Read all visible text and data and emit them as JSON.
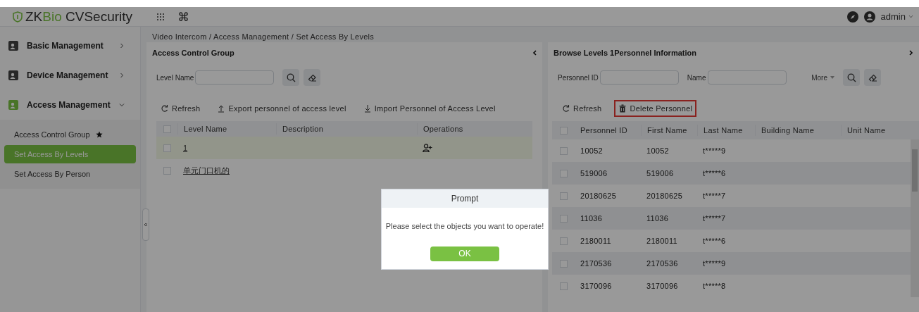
{
  "header": {
    "logo": {
      "part_1": "ZK",
      "part_2": "Bio",
      "part_3": " CVSecurity"
    },
    "user": "admin"
  },
  "sidebar": {
    "menus": [
      {
        "label": "Basic Management",
        "expanded": false
      },
      {
        "label": "Device Management",
        "expanded": false
      },
      {
        "label": "Access Management",
        "expanded": true,
        "items": [
          {
            "label": "Access Control Group",
            "selected": false,
            "starred": true
          },
          {
            "label": "Set Access By Levels",
            "selected": true,
            "starred": false
          },
          {
            "label": "Set Access By Person",
            "selected": false,
            "starred": false
          }
        ]
      }
    ]
  },
  "breadcrumb": "Video Intercom / Access Management / Set Access By Levels",
  "left_panel": {
    "title": "Access Control Group",
    "filters": [
      {
        "label": "Level Name"
      }
    ],
    "actions": [
      {
        "kind": "refresh",
        "label": "Refresh",
        "highlighted": false
      },
      {
        "kind": "export",
        "label": "Export personnel of access level",
        "highlighted": false
      },
      {
        "kind": "import",
        "label": "Import Personnel of Access Level",
        "highlighted": false
      }
    ],
    "table": {
      "all_checked": false,
      "columns": [
        "Level Name",
        "Description",
        "Operations"
      ],
      "rows": [
        {
          "level_name": "1",
          "selected": true,
          "checked": false,
          "add_personnel": true
        },
        {
          "level_name": "单元门口机的",
          "selected": false,
          "checked": false,
          "add_personnel": false
        }
      ]
    }
  },
  "right_panel": {
    "title": "Browse Levels 1Personnel Information",
    "filters": [
      {
        "label": "Personnel ID"
      },
      {
        "label": "Name"
      }
    ],
    "more": "More",
    "actions": [
      {
        "kind": "refresh",
        "label": "Refresh",
        "highlighted": false
      },
      {
        "kind": "delete",
        "label": "Delete Personnel",
        "highlighted": true
      }
    ],
    "table": {
      "all_checked": false,
      "columns": [
        "Personnel ID",
        "First Name",
        "Last Name",
        "Building Name",
        "Unit Name"
      ],
      "rows": [
        {
          "checked": false,
          "cells": [
            "10052",
            "10052",
            "t*****9"
          ]
        },
        {
          "checked": false,
          "cells": [
            "519006",
            "519006",
            "t*****6"
          ]
        },
        {
          "checked": false,
          "cells": [
            "20180625",
            "20180625",
            "t*****7"
          ]
        },
        {
          "checked": false,
          "cells": [
            "11036",
            "11036",
            "t*****7"
          ]
        },
        {
          "checked": false,
          "cells": [
            "2180011",
            "2180011",
            "t*****6"
          ]
        },
        {
          "checked": false,
          "cells": [
            "2170536",
            "2170536",
            "t*****9"
          ]
        },
        {
          "checked": false,
          "cells": [
            "3170096",
            "3170096",
            "t*****8"
          ]
        }
      ]
    }
  },
  "dialog": {
    "title": "Prompt",
    "message": "Please select the objects you want to operate!",
    "button": "OK"
  }
}
